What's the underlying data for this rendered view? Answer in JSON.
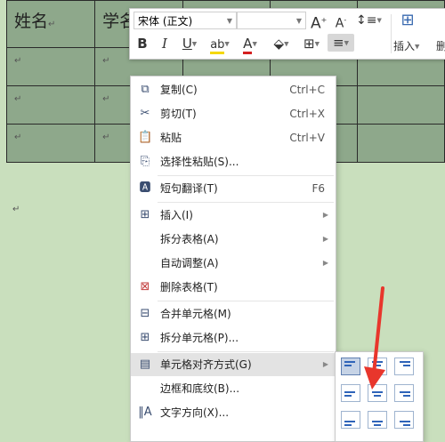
{
  "table": {
    "header": [
      "姓名",
      "学名"
    ],
    "para_mark": "↵"
  },
  "toolbar": {
    "font_name": "宋体 (正文)",
    "font_size": "",
    "grow_font": "A",
    "shrink_font": "A",
    "bold": "B",
    "italic": "I",
    "underline": "U",
    "insert_label": "插入",
    "delete_label": "删"
  },
  "menu": {
    "copy": {
      "label": "复制(C)",
      "shortcut": "Ctrl+C"
    },
    "cut": {
      "label": "剪切(T)",
      "shortcut": "Ctrl+X"
    },
    "paste": {
      "label": "粘贴",
      "shortcut": "Ctrl+V"
    },
    "paste_special": {
      "label": "选择性粘贴(S)..."
    },
    "translate": {
      "label": "短句翻译(T)",
      "shortcut": "F6"
    },
    "insert": {
      "label": "插入(I)"
    },
    "split_table": {
      "label": "拆分表格(A)"
    },
    "autofit": {
      "label": "自动调整(A)"
    },
    "delete_table": {
      "label": "删除表格(T)"
    },
    "merge_cells": {
      "label": "合并单元格(M)"
    },
    "split_cells": {
      "label": "拆分单元格(P)..."
    },
    "cell_align": {
      "label": "单元格对齐方式(G)"
    },
    "borders": {
      "label": "边框和底纹(B)..."
    },
    "text_direction": {
      "label": "文字方向(X)..."
    }
  },
  "colors": {
    "page_bg": "#c9dfbd",
    "table_fill": "#8ea88b",
    "arrow": "#e8362c",
    "align_icon": "#2f64b9"
  }
}
